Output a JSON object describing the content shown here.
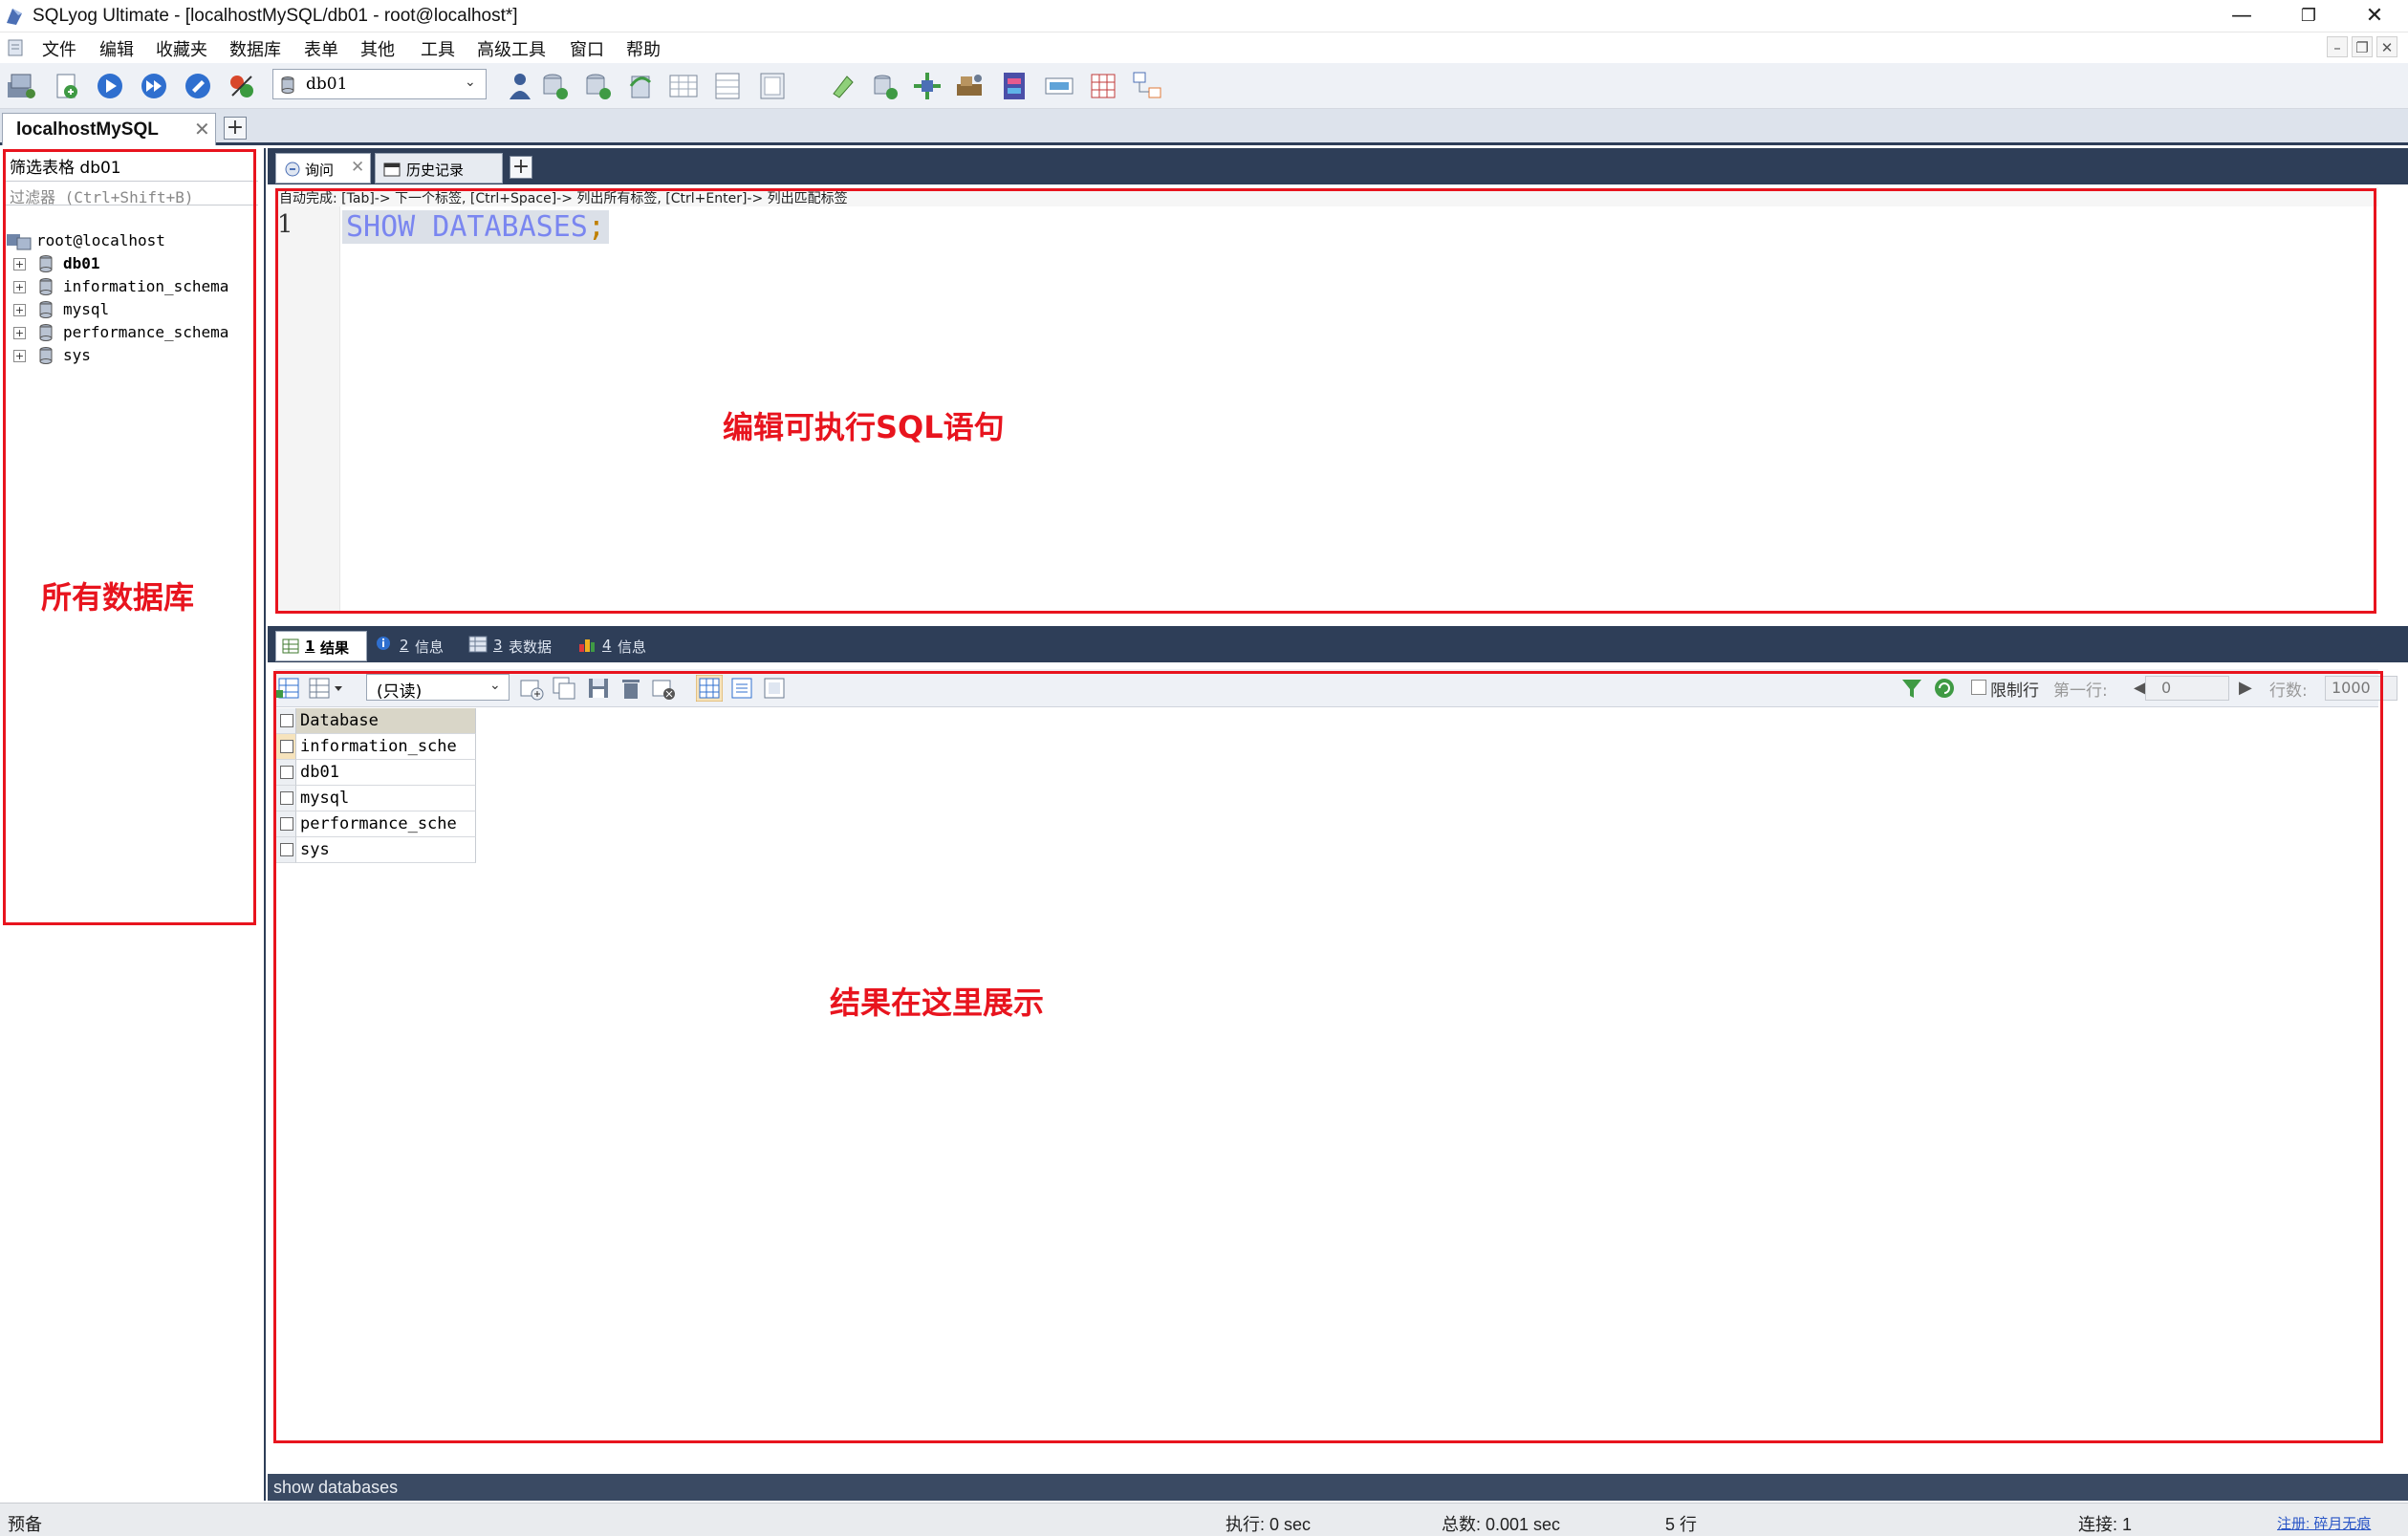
{
  "window": {
    "title": "SQLyog Ultimate - [localhostMySQL/db01 - root@localhost*]",
    "controls": {
      "minimize": "—",
      "maximize": "❐",
      "close": "✕"
    }
  },
  "menu": {
    "items": [
      "文件",
      "编辑",
      "收藏夹",
      "数据库",
      "表单",
      "其他",
      "工具",
      "高级工具",
      "窗口",
      "帮助"
    ]
  },
  "toolbar": {
    "database_selected": "db01"
  },
  "connection_tab": {
    "label": "localhostMySQL",
    "close": "✕",
    "add": "+"
  },
  "object_browser": {
    "filter_label": "筛选表格  db01",
    "filter_placeholder": "过滤器 (Ctrl+Shift+B)",
    "root": "root@localhost",
    "databases": [
      {
        "name": "db01",
        "bold": true
      },
      {
        "name": "information_schema",
        "bold": false
      },
      {
        "name": "mysql",
        "bold": false
      },
      {
        "name": "performance_schema",
        "bold": false
      },
      {
        "name": "sys",
        "bold": false
      }
    ]
  },
  "query_tabs": {
    "query_label": "询问",
    "history_label": "历史记录",
    "add": "+"
  },
  "editor": {
    "hint": "自动完成:  [Tab]-> 下一个标签,  [Ctrl+Space]-> 列出所有标签,  [Ctrl+Enter]-> 列出匹配标签",
    "line_number": "1",
    "sql_keyword": "SHOW DATABASES",
    "sql_terminator": ";"
  },
  "result_tabs": [
    {
      "num": "1",
      "label": "结果"
    },
    {
      "num": "2",
      "label": "信息"
    },
    {
      "num": "3",
      "label": "表数据"
    },
    {
      "num": "4",
      "label": "信息"
    }
  ],
  "result_toolbar": {
    "mode": "(只读)",
    "limit_rows_label": "限制行",
    "first_row_label": "第一行:",
    "first_row_value": "0",
    "rows_label": "行数:",
    "rows_value": "1000"
  },
  "result_grid": {
    "column": "Database",
    "rows": [
      "information_sche",
      "db01",
      "mysql",
      "performance_sche",
      "sys"
    ]
  },
  "annotations": {
    "editor": "编辑可执行SQL语句",
    "databases": "所有数据库",
    "results": "结果在这里展示",
    "color": "#e8141e"
  },
  "sql_status": "show databases",
  "statusbar": {
    "ready": "预备",
    "exec": "执行: 0 sec",
    "total": "总数: 0.001 sec",
    "rows": "5 行",
    "connections": "连接: 1",
    "link": "注册: 碎月无痕"
  }
}
